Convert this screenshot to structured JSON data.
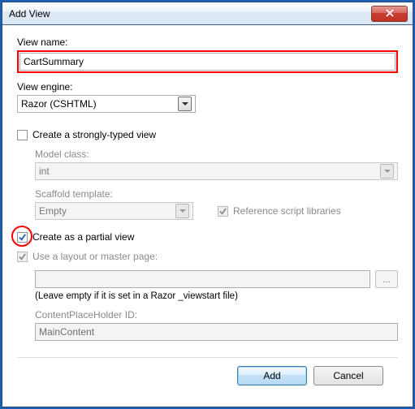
{
  "title": "Add View",
  "view_name_label": "View name:",
  "view_name_value": "CartSummary",
  "view_engine_label": "View engine:",
  "view_engine_value": "Razor (CSHTML)",
  "strongly_typed": {
    "label": "Create a strongly-typed view",
    "checked": false,
    "model_class_label": "Model class:",
    "model_class_value": "int",
    "scaffold_label": "Scaffold template:",
    "scaffold_value": "Empty",
    "ref_scripts_label": "Reference script libraries",
    "ref_scripts_checked": true
  },
  "partial": {
    "label": "Create as a partial view",
    "checked": true
  },
  "layout": {
    "use_layout_label": "Use a layout or master page:",
    "use_layout_checked": true,
    "layout_path_value": "",
    "browse_label": "...",
    "hint": "(Leave empty if it is set in a Razor _viewstart file)",
    "cph_label": "ContentPlaceHolder ID:",
    "cph_value": "MainContent"
  },
  "buttons": {
    "add": "Add",
    "cancel": "Cancel"
  }
}
